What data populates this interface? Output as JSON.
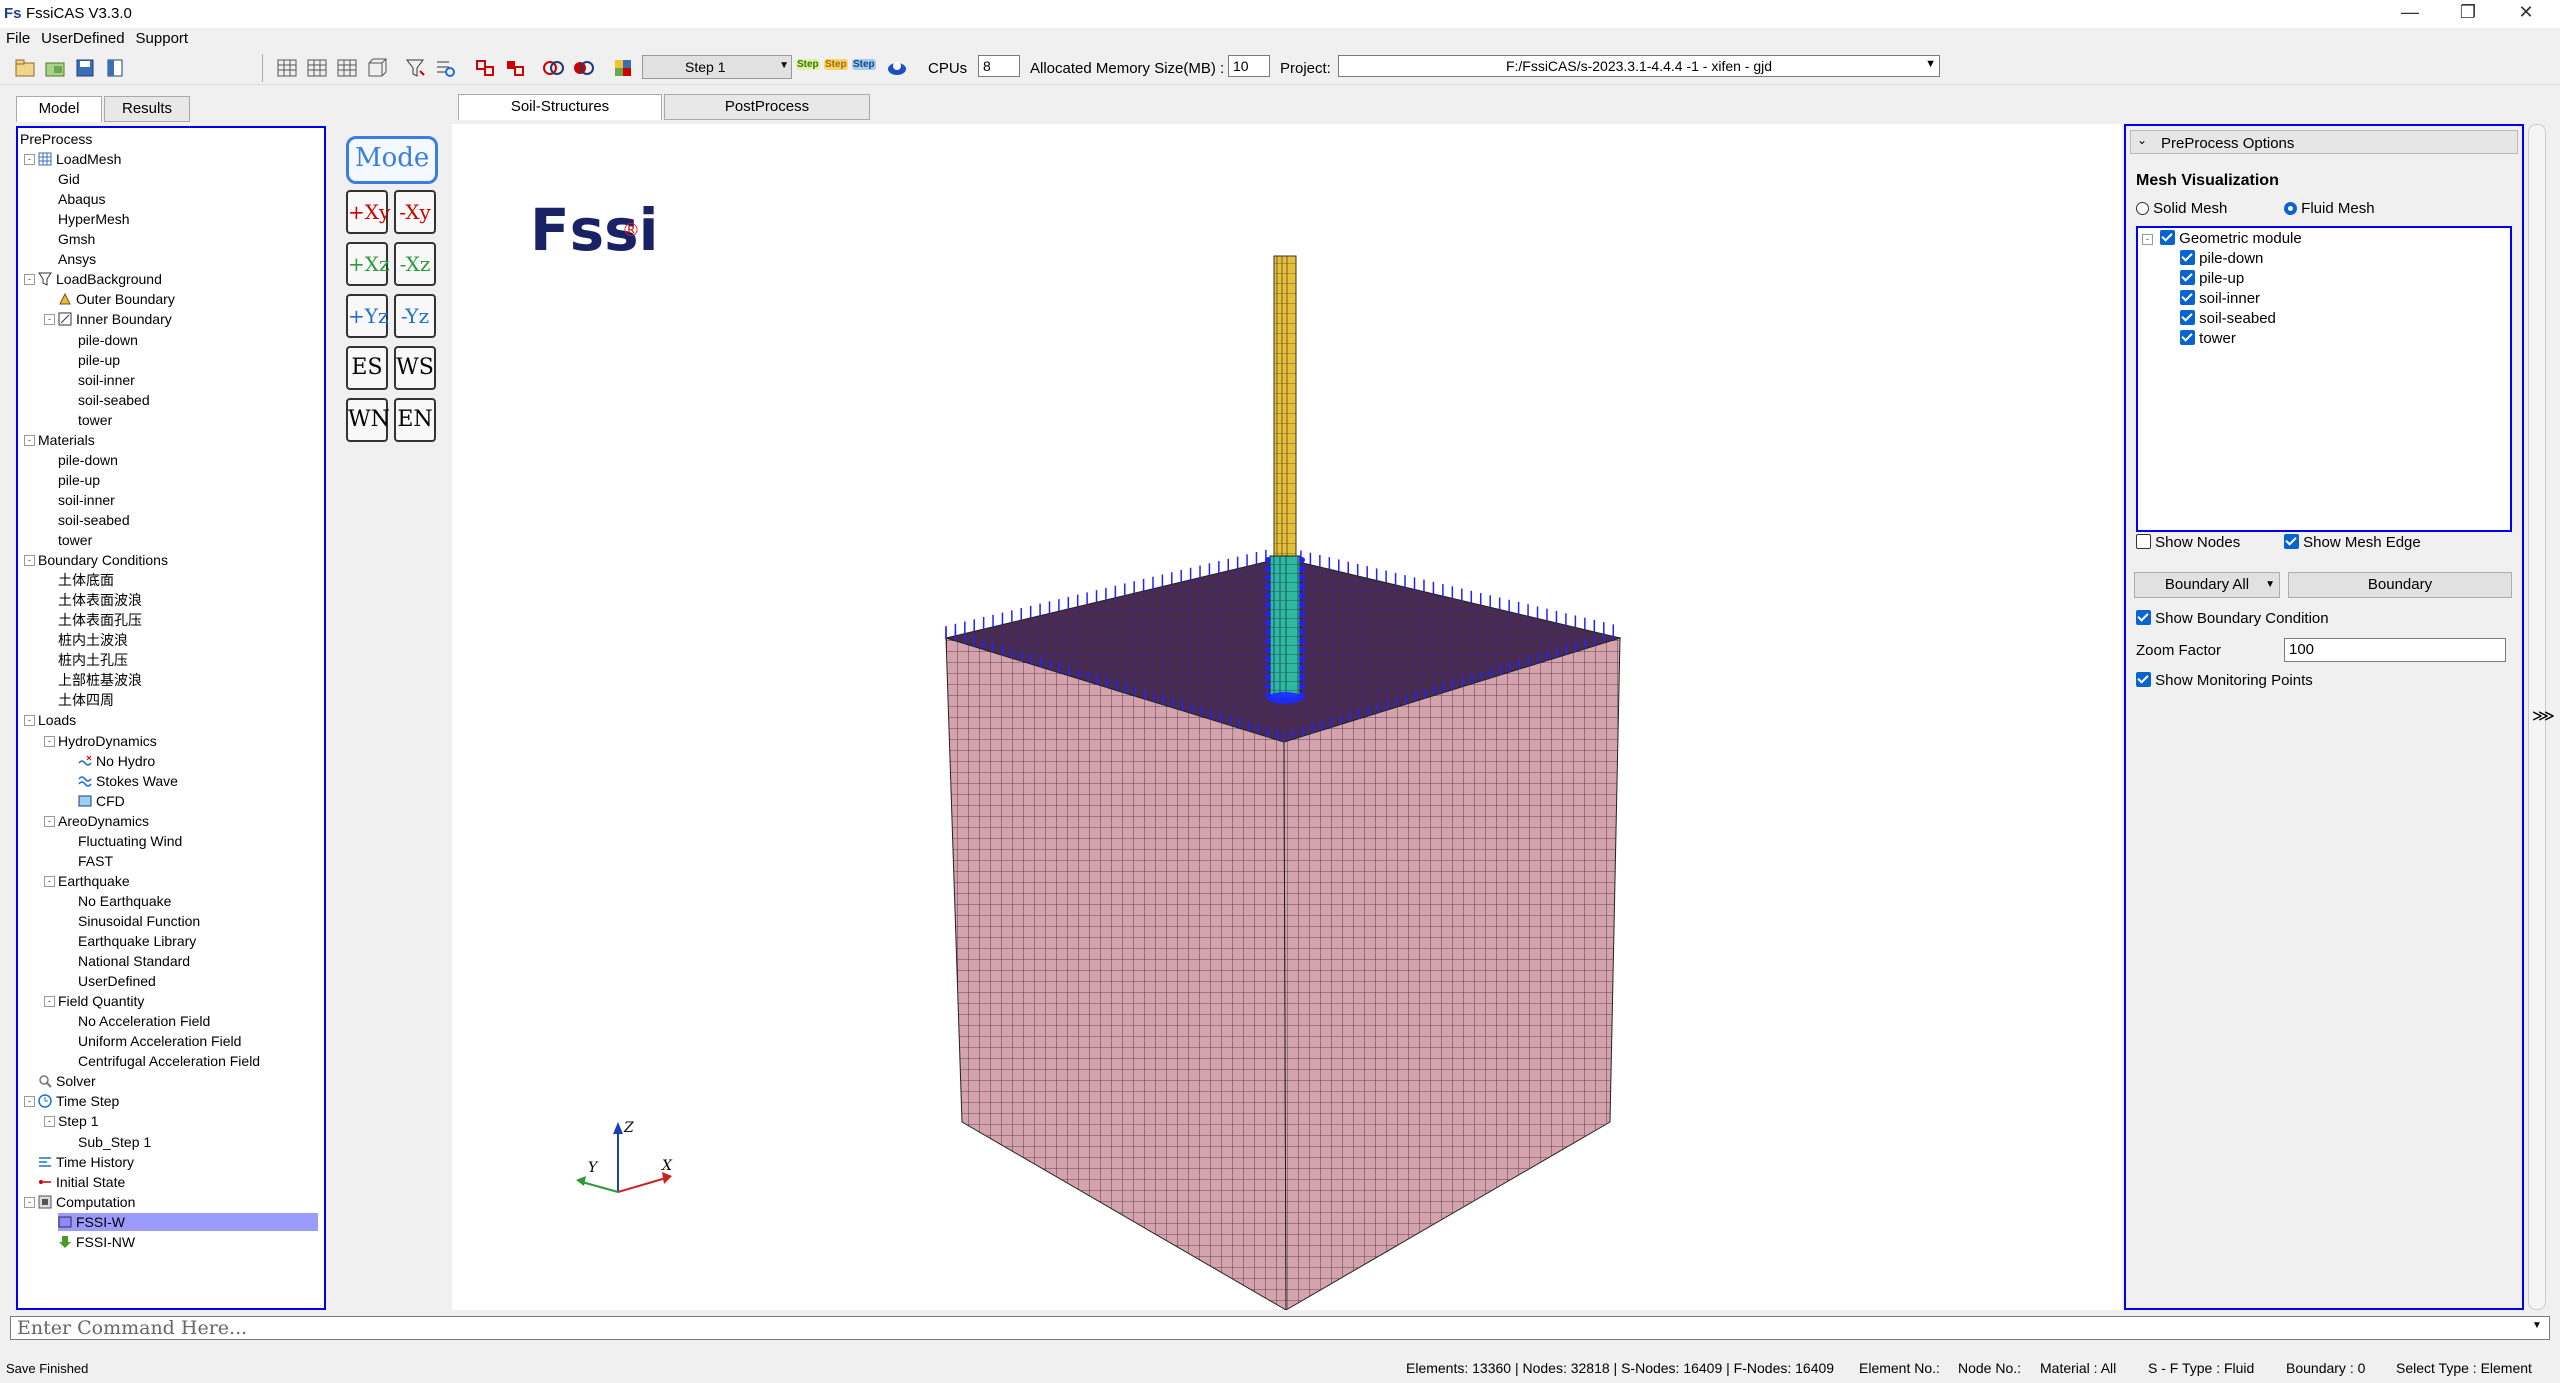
{
  "window": {
    "title": "FssiCAS V3.3.0",
    "logo": "Fs"
  },
  "menu": [
    "File",
    "UserDefined",
    "Support"
  ],
  "toolbar": {
    "step_combo": "Step 1",
    "step_buttons": [
      "Step",
      "Step",
      "Step"
    ],
    "cpus_label": "CPUs",
    "cpus_value": "8",
    "memory_label": "Allocated Memory Size(MB) :",
    "memory_value": "10",
    "project_label": "Project:",
    "project_value": "F:/FssiCAS/s-2023.3.1-4.4.4 -1 - xifen - gjd"
  },
  "left_tabs": [
    "Model",
    "Results"
  ],
  "center_tabs": [
    "Soil-Structures",
    "PostProcess"
  ],
  "tree": [
    {
      "label": "PreProcess",
      "level": 0,
      "exp": "",
      "icon": ""
    },
    {
      "label": "LoadMesh",
      "level": 1,
      "exp": "-",
      "icon": "mesh-icon"
    },
    {
      "label": "Gid",
      "level": 2,
      "exp": "",
      "icon": ""
    },
    {
      "label": "Abaqus",
      "level": 2,
      "exp": "",
      "icon": ""
    },
    {
      "label": "HyperMesh",
      "level": 2,
      "exp": "",
      "icon": ""
    },
    {
      "label": "Gmsh",
      "level": 2,
      "exp": "",
      "icon": ""
    },
    {
      "label": "Ansys",
      "level": 2,
      "exp": "",
      "icon": ""
    },
    {
      "label": "LoadBackground",
      "level": 1,
      "exp": "-",
      "icon": "funnel-icon"
    },
    {
      "label": "Outer Boundary",
      "level": 2,
      "exp": "",
      "icon": "boundary-icon"
    },
    {
      "label": "Inner Boundary",
      "level": 2,
      "exp": "-",
      "icon": "inner-boundary-icon"
    },
    {
      "label": "pile-down",
      "level": 3,
      "exp": "",
      "icon": ""
    },
    {
      "label": "pile-up",
      "level": 3,
      "exp": "",
      "icon": ""
    },
    {
      "label": "soil-inner",
      "level": 3,
      "exp": "",
      "icon": ""
    },
    {
      "label": "soil-seabed",
      "level": 3,
      "exp": "",
      "icon": ""
    },
    {
      "label": "tower",
      "level": 3,
      "exp": "",
      "icon": ""
    },
    {
      "label": "Materials",
      "level": 1,
      "exp": "-",
      "icon": ""
    },
    {
      "label": "pile-down",
      "level": 2,
      "exp": "",
      "icon": ""
    },
    {
      "label": "pile-up",
      "level": 2,
      "exp": "",
      "icon": ""
    },
    {
      "label": "soil-inner",
      "level": 2,
      "exp": "",
      "icon": ""
    },
    {
      "label": "soil-seabed",
      "level": 2,
      "exp": "",
      "icon": ""
    },
    {
      "label": "tower",
      "level": 2,
      "exp": "",
      "icon": ""
    },
    {
      "label": "Boundary Conditions",
      "level": 1,
      "exp": "-",
      "icon": ""
    },
    {
      "label": "土体底面",
      "level": 2,
      "exp": "",
      "icon": ""
    },
    {
      "label": "土体表面波浪",
      "level": 2,
      "exp": "",
      "icon": ""
    },
    {
      "label": "土体表面孔压",
      "level": 2,
      "exp": "",
      "icon": ""
    },
    {
      "label": "桩内土波浪",
      "level": 2,
      "exp": "",
      "icon": ""
    },
    {
      "label": "桩内土孔压",
      "level": 2,
      "exp": "",
      "icon": ""
    },
    {
      "label": "上部桩基波浪",
      "level": 2,
      "exp": "",
      "icon": ""
    },
    {
      "label": "土体四周",
      "level": 2,
      "exp": "",
      "icon": ""
    },
    {
      "label": "Loads",
      "level": 1,
      "exp": "-",
      "icon": ""
    },
    {
      "label": "HydroDynamics",
      "level": 2,
      "exp": "-",
      "icon": ""
    },
    {
      "label": "No Hydro",
      "level": 3,
      "exp": "",
      "icon": "wave-x-icon"
    },
    {
      "label": "Stokes Wave",
      "level": 3,
      "exp": "",
      "icon": "wave-icon"
    },
    {
      "label": "CFD",
      "level": 3,
      "exp": "",
      "icon": "cfd-icon"
    },
    {
      "label": "AreoDynamics",
      "level": 2,
      "exp": "-",
      "icon": ""
    },
    {
      "label": "Fluctuating Wind",
      "level": 3,
      "exp": "",
      "icon": ""
    },
    {
      "label": "FAST",
      "level": 3,
      "exp": "",
      "icon": ""
    },
    {
      "label": "Earthquake",
      "level": 2,
      "exp": "-",
      "icon": ""
    },
    {
      "label": "No Earthquake",
      "level": 3,
      "exp": "",
      "icon": ""
    },
    {
      "label": "Sinusoidal Function",
      "level": 3,
      "exp": "",
      "icon": ""
    },
    {
      "label": "Earthquake Library",
      "level": 3,
      "exp": "",
      "icon": ""
    },
    {
      "label": "National Standard",
      "level": 3,
      "exp": "",
      "icon": ""
    },
    {
      "label": "UserDefined",
      "level": 3,
      "exp": "",
      "icon": ""
    },
    {
      "label": "Field Quantity",
      "level": 2,
      "exp": "-",
      "icon": ""
    },
    {
      "label": "No Acceleration Field",
      "level": 3,
      "exp": "",
      "icon": ""
    },
    {
      "label": "Uniform Acceleration Field",
      "level": 3,
      "exp": "",
      "icon": ""
    },
    {
      "label": "Centrifugal Acceleration Field",
      "level": 3,
      "exp": "",
      "icon": ""
    },
    {
      "label": "Solver",
      "level": 1,
      "exp": "",
      "icon": "solver-icon"
    },
    {
      "label": "Time Step",
      "level": 1,
      "exp": "-",
      "icon": "clock-icon"
    },
    {
      "label": "Step 1",
      "level": 2,
      "exp": "-",
      "icon": ""
    },
    {
      "label": "Sub_Step 1",
      "level": 3,
      "exp": "",
      "icon": ""
    },
    {
      "label": "Time History",
      "level": 1,
      "exp": "",
      "icon": "time-history-icon"
    },
    {
      "label": "Initial State",
      "level": 1,
      "exp": "",
      "icon": "initial-state-icon"
    },
    {
      "label": "Computation",
      "level": 1,
      "exp": "-",
      "icon": "computation-icon"
    },
    {
      "label": "FSSI-W",
      "level": 2,
      "exp": "",
      "icon": "fssi-w-icon"
    },
    {
      "label": "FSSI-NW",
      "level": 2,
      "exp": "",
      "icon": "fssi-nw-icon"
    }
  ],
  "view_buttons": {
    "mode": "Mode",
    "plus_xy": "+Xy",
    "minus_xy": "-Xy",
    "plus_xz": "+Xz",
    "minus_xz": "-Xz",
    "plus_yz": "+Yz",
    "minus_yz": "-Yz",
    "es": "ES",
    "ws": "WS",
    "wn": "WN",
    "en": "EN"
  },
  "viewport": {
    "logo_text": "Fssi",
    "logo_mark": "®",
    "axes": {
      "x": "X",
      "y": "Y",
      "z": "Z"
    }
  },
  "preprocess_options": {
    "header": "PreProcess Options",
    "mesh_visualization": "Mesh Visualization",
    "solid_mesh": "Solid Mesh",
    "fluid_mesh": "Fluid Mesh",
    "geometric_module": "Geometric module",
    "modules": [
      "pile-down",
      "pile-up",
      "soil-inner",
      "soil-seabed",
      "tower"
    ],
    "show_nodes": "Show Nodes",
    "show_mesh_edge": "Show Mesh Edge",
    "boundary_all": "Boundary All",
    "boundary": "Boundary",
    "show_boundary_condition": "Show Boundary Condition",
    "zoom_factor_label": "Zoom Factor",
    "zoom_factor_value": "100",
    "show_monitoring_points": "Show Monitoring Points"
  },
  "command": {
    "placeholder": "Enter Command Here..."
  },
  "status": {
    "left": "Save Finished",
    "elements": "Elements: 13360 | Nodes: 32818 | S-Nodes: 16409 | F-Nodes: 16409",
    "element_no": "Element No.:",
    "node_no": "Node No.:",
    "material": "Material :   All",
    "sf_type": "S - F Type :   Fluid",
    "boundary": "Boundary :   0",
    "select_type": "Select Type :   Element"
  },
  "colors": {
    "accent": "#0000ee",
    "tower": "#e6bf3a",
    "pile": "#2fb8a0",
    "soil": "#d5a3ad",
    "top": "#4a2b49"
  }
}
